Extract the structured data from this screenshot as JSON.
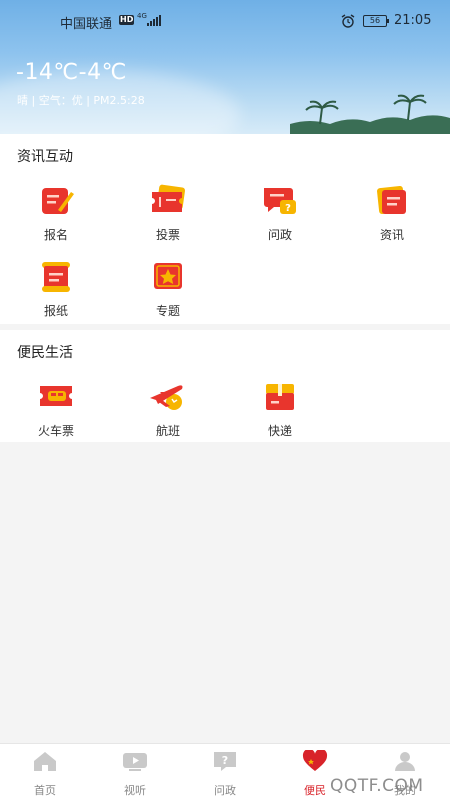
{
  "status": {
    "carrier": "中国联通",
    "hd": "HD",
    "net": "4G",
    "battery": "56",
    "time": "21:05"
  },
  "weather": {
    "temperature": "-14℃-4℃",
    "detail": "晴 | 空气：优 | PM2.5:28"
  },
  "section1": {
    "title": "资讯互动",
    "items": [
      {
        "label": "报名",
        "icon": "signup-pencil-icon"
      },
      {
        "label": "投票",
        "icon": "vote-ticket-icon"
      },
      {
        "label": "问政",
        "icon": "question-chat-icon"
      },
      {
        "label": "资讯",
        "icon": "news-doc-icon"
      },
      {
        "label": "报纸",
        "icon": "newspaper-scroll-icon"
      },
      {
        "label": "专题",
        "icon": "topic-star-icon"
      }
    ]
  },
  "section2": {
    "title": "便民生活",
    "items": [
      {
        "label": "火车票",
        "icon": "train-ticket-icon"
      },
      {
        "label": "航班",
        "icon": "airplane-icon"
      },
      {
        "label": "快递",
        "icon": "parcel-box-icon"
      }
    ]
  },
  "tabs": [
    {
      "label": "首页",
      "icon": "home-icon"
    },
    {
      "label": "视听",
      "icon": "video-play-icon"
    },
    {
      "label": "问政",
      "icon": "question-icon"
    },
    {
      "label": "便民",
      "icon": "heart-icon",
      "active": true
    },
    {
      "label": "我的",
      "icon": "user-icon"
    }
  ],
  "watermark": "QQTF.COM",
  "colors": {
    "accent": "#d8232a",
    "icon_red": "#e8352d",
    "icon_yellow": "#f7b500"
  }
}
